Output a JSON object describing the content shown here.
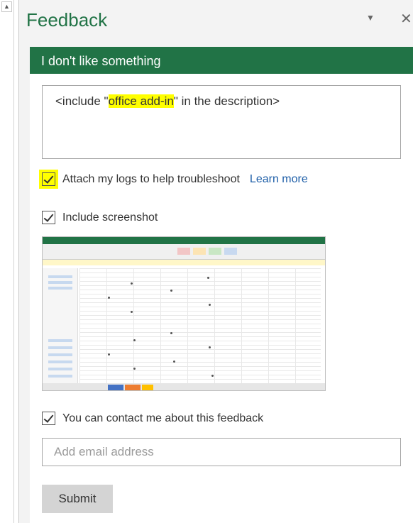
{
  "pane": {
    "title": "Feedback",
    "menu_icon": "chevron-down-icon",
    "close_icon": "close-icon"
  },
  "banner": {
    "title": "I don't like something"
  },
  "description": {
    "prefix": "<include \"",
    "highlighted": "office add-in",
    "suffix": "\" in the description>"
  },
  "options": {
    "attach_logs": {
      "label": "Attach my logs to help troubleshoot",
      "checked": true,
      "link": "Learn more"
    },
    "include_screenshot": {
      "label": "Include screenshot",
      "checked": true
    },
    "contact_me": {
      "label": "You can contact me about this feedback",
      "checked": true
    }
  },
  "email": {
    "placeholder": "Add email address",
    "value": ""
  },
  "submit": {
    "label": "Submit"
  },
  "colors": {
    "accent": "#217346",
    "highlight": "#ffff00",
    "link": "#1f5fa8"
  }
}
